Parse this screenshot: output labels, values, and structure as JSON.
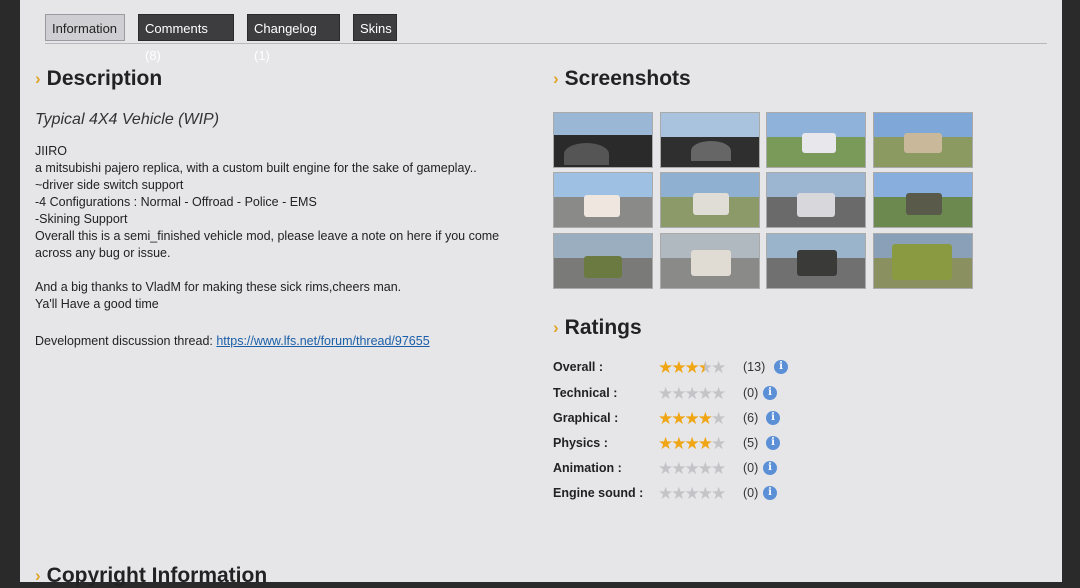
{
  "tabs": [
    {
      "label": "Information",
      "active": true
    },
    {
      "label": "Comments (8)",
      "active": false
    },
    {
      "label": "Changelog (1)",
      "active": false
    },
    {
      "label": "Skins",
      "active": false
    }
  ],
  "description": {
    "title": "Description",
    "subtitle": "Typical 4X4 Vehicle (WIP)",
    "lines": [
      "JIIRO",
      "a mitsubishi pajero replica, with a custom built engine for the sake of gameplay..",
      "~driver side switch support",
      "-4 Configurations : Normal - Offroad - Police - EMS",
      "-Skining Support",
      "Overall this is a semi_finished vehicle mod, please leave a note on here if you come across any bug or issue."
    ],
    "thanks_1": "And a big thanks to VladM for making these sick rims,cheers man.",
    "thanks_2": "Ya'll Have a good time",
    "dev_label": "Development discussion thread: ",
    "dev_link": "https://www.lfs.net/forum/thread/97655"
  },
  "screenshots": {
    "title": "Screenshots"
  },
  "ratings": {
    "title": "Ratings",
    "rows": [
      {
        "label": "Overall :",
        "stars": 3.5,
        "count": "(13)"
      },
      {
        "label": "Technical :",
        "stars": 0,
        "count": "(0)"
      },
      {
        "label": "Graphical :",
        "stars": 4,
        "count": "(6)"
      },
      {
        "label": "Physics :",
        "stars": 4,
        "count": "(5)"
      },
      {
        "label": "Animation :",
        "stars": 0,
        "count": "(0)"
      },
      {
        "label": "Engine sound :",
        "stars": 0,
        "count": "(0)"
      }
    ]
  },
  "copyright": {
    "title": "Copyright Information"
  },
  "colors": {
    "accent": "#e0a52b",
    "star_on": "#f0a614",
    "link": "#1a5fa8"
  }
}
